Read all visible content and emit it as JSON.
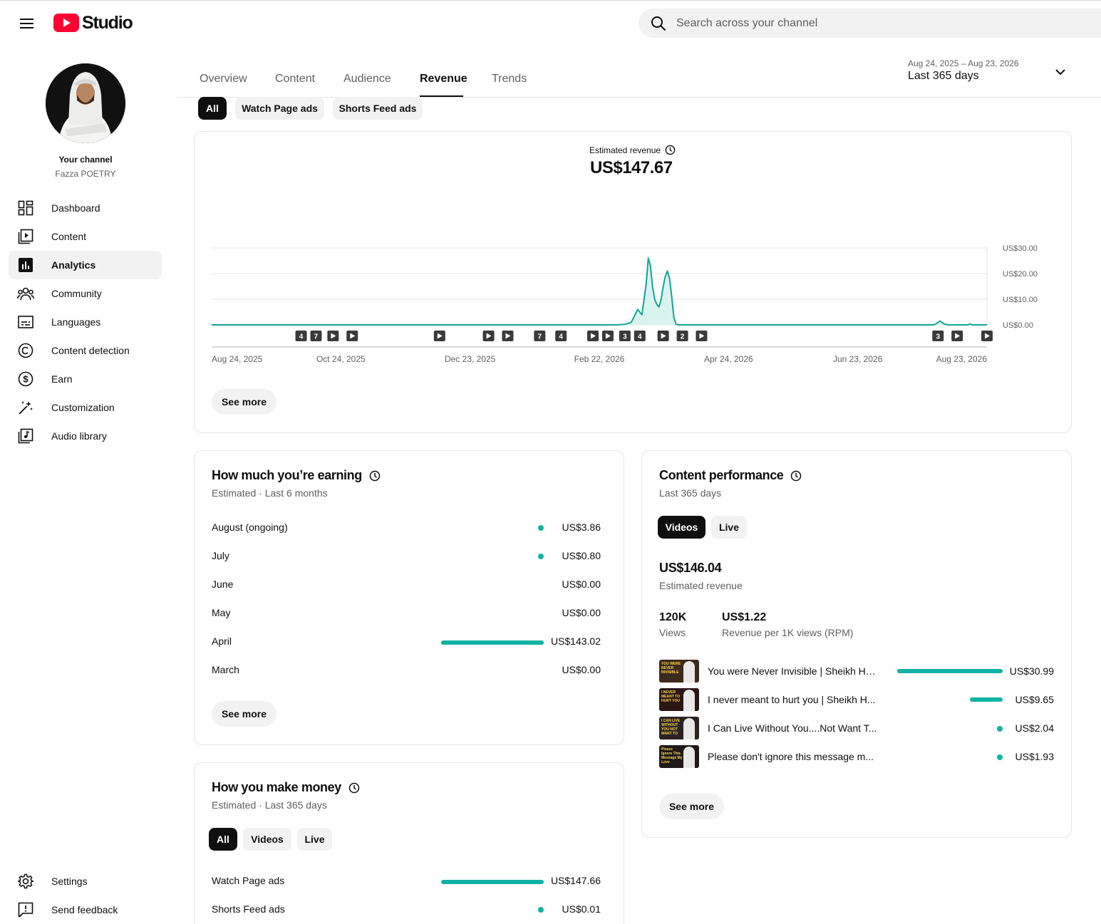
{
  "header": {
    "logo_text": "Studio",
    "search_placeholder": "Search across your channel"
  },
  "channel": {
    "title": "Your channel",
    "name": "Fazza POETRY"
  },
  "sidebar": {
    "items": [
      {
        "label": "Dashboard",
        "icon": "dashboard-icon"
      },
      {
        "label": "Content",
        "icon": "content-icon"
      },
      {
        "label": "Analytics",
        "icon": "analytics-icon",
        "active": true
      },
      {
        "label": "Community",
        "icon": "community-icon"
      },
      {
        "label": "Languages",
        "icon": "subtitles-icon"
      },
      {
        "label": "Content detection",
        "icon": "copyright-icon"
      },
      {
        "label": "Earn",
        "icon": "dollar-icon"
      },
      {
        "label": "Customization",
        "icon": "magic-wand-icon"
      },
      {
        "label": "Audio library",
        "icon": "audio-library-icon"
      }
    ],
    "bottom": [
      {
        "label": "Settings",
        "icon": "gear-icon"
      },
      {
        "label": "Send feedback",
        "icon": "feedback-icon"
      }
    ]
  },
  "tabs": [
    "Overview",
    "Content",
    "Audience",
    "Revenue",
    "Trends"
  ],
  "active_tab": "Revenue",
  "date_range": {
    "range": "Aug 24, 2025 – Aug 23, 2026",
    "label": "Last 365 days"
  },
  "filter_chips": [
    "All",
    "Watch Page ads",
    "Shorts Feed ads"
  ],
  "revenue_chart": {
    "metric_label": "Estimated revenue",
    "total": "US$147.67",
    "see_more": "See more"
  },
  "chart_data": {
    "type": "area",
    "title": "Estimated revenue",
    "x_tick_labels": [
      "Aug 24, 2025",
      "Oct 24, 2025",
      "Dec 23, 2025",
      "Feb 22, 2026",
      "Apr 24, 2026",
      "Jun 23, 2026",
      "Aug 23, 2026"
    ],
    "y_tick_labels": [
      "US$30.00",
      "US$20.00",
      "US$10.00",
      "US$0.00"
    ],
    "y_ticks": [
      30,
      20,
      10,
      0
    ],
    "ylim": [
      0,
      30
    ],
    "x_range_days": [
      0,
      364
    ],
    "series": [
      {
        "color": "#12a594",
        "points": [
          [
            0,
            0
          ],
          [
            190,
            0
          ],
          [
            194,
            0.2
          ],
          [
            197,
            1
          ],
          [
            200,
            6
          ],
          [
            202,
            4
          ],
          [
            204,
            16
          ],
          [
            205,
            26
          ],
          [
            206,
            23
          ],
          [
            207,
            15
          ],
          [
            208,
            10
          ],
          [
            209,
            8
          ],
          [
            210,
            7
          ],
          [
            211,
            10
          ],
          [
            212,
            15
          ],
          [
            213,
            19
          ],
          [
            214,
            21
          ],
          [
            215,
            18
          ],
          [
            216,
            11
          ],
          [
            217,
            3
          ],
          [
            218,
            0.3
          ],
          [
            219,
            0
          ],
          [
            339,
            0
          ],
          [
            340,
            0.4
          ],
          [
            342,
            1.5
          ],
          [
            344,
            0.3
          ],
          [
            346,
            0
          ],
          [
            355,
            0
          ],
          [
            356,
            0.4
          ],
          [
            357,
            0
          ],
          [
            364,
            0
          ]
        ]
      }
    ],
    "markers": [
      {
        "day": 42,
        "label": "4"
      },
      {
        "day": 49,
        "label": "7"
      },
      {
        "day": 57,
        "label": ""
      },
      {
        "day": 66,
        "label": ""
      },
      {
        "day": 107,
        "label": ""
      },
      {
        "day": 130,
        "label": ""
      },
      {
        "day": 139,
        "label": ""
      },
      {
        "day": 154,
        "label": "7"
      },
      {
        "day": 164,
        "label": "4"
      },
      {
        "day": 179,
        "label": ""
      },
      {
        "day": 186,
        "label": ""
      },
      {
        "day": 194,
        "label": "3"
      },
      {
        "day": 201,
        "label": "4"
      },
      {
        "day": 212,
        "label": ""
      },
      {
        "day": 221,
        "label": "2"
      },
      {
        "day": 230,
        "label": ""
      },
      {
        "day": 341,
        "label": "3"
      },
      {
        "day": 350,
        "label": ""
      },
      {
        "day": 364,
        "label": ""
      }
    ],
    "grid": true
  },
  "earning": {
    "title": "How much you’re earning",
    "subtitle": "Estimated · Last 6 months",
    "color": "#10b3a3",
    "rows": [
      {
        "label": "August (ongoing)",
        "value": "US$3.86",
        "amount": 3.86
      },
      {
        "label": "July",
        "value": "US$0.80",
        "amount": 0.8
      },
      {
        "label": "June",
        "value": "US$0.00",
        "amount": 0
      },
      {
        "label": "May",
        "value": "US$0.00",
        "amount": 0
      },
      {
        "label": "April",
        "value": "US$143.02",
        "amount": 143.02
      },
      {
        "label": "March",
        "value": "US$0.00",
        "amount": 0
      }
    ],
    "see_more": "See more"
  },
  "make_money": {
    "title": "How you make money",
    "subtitle": "Estimated · Last 365 days",
    "chips": [
      "All",
      "Videos",
      "Live"
    ],
    "rows": [
      {
        "label": "Watch Page ads",
        "value": "US$147.66",
        "amount": 147.66
      },
      {
        "label": "Shorts Feed ads",
        "value": "US$0.01",
        "amount": 0.01
      }
    ]
  },
  "content_perf": {
    "title": "Content performance",
    "subtitle": "Last 365 days",
    "chips": [
      "Videos",
      "Live"
    ],
    "revenue_value": "US$146.04",
    "revenue_label": "Estimated revenue",
    "views_value": "120K",
    "views_label": "Views",
    "rpm_value": "US$1.22",
    "rpm_label": "Revenue per 1K views (RPM)",
    "videos": [
      {
        "title": "You were Never Invisible | Sheikh Ha...",
        "value": "US$30.99",
        "amount": 30.99,
        "thumb_text": "YOU WERE NEVER INVISIBLE"
      },
      {
        "title": "I never meant to hurt you | Sheikh H...",
        "value": "US$9.65",
        "amount": 9.65,
        "thumb_text": "I NEVER MEANT TO HURT YOU"
      },
      {
        "title": "I Can Live Without You....Not Want T...",
        "value": "US$2.04",
        "amount": 2.04,
        "thumb_text": "I CAN LIVE WITHOUT YOU NOT WANT TO"
      },
      {
        "title": "Please don't ignore this message m...",
        "value": "US$1.93",
        "amount": 1.93,
        "thumb_text": "Please Ignore This Message My Love"
      }
    ],
    "see_more": "See more"
  }
}
